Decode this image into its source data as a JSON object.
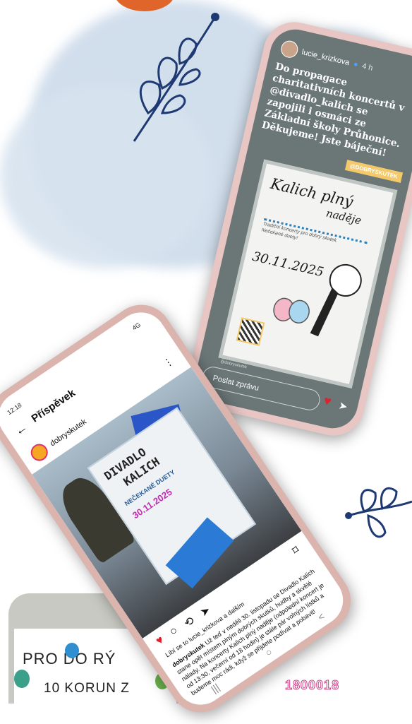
{
  "colors": {
    "accent_orange": "#e0652a",
    "leaf_navy": "#1f3a73",
    "like_red": "#e0202c",
    "wash_blue": "#b9cbe0"
  },
  "story": {
    "username": "lucie_krizkova",
    "time": "4 h",
    "text": "Do propagace charitativních koncertů v @divadlo_kalich se zapojili i osmáci ze Základní školy Průhonice. Děkujeme! Jste báječní!",
    "tag": "@DOBRYSKUTEK",
    "poster_title": "Kalich plný",
    "poster_subtitle": "naděje",
    "poster_small": "Tradiční koncerty pro dobrý skutek. Nečekané duety!",
    "poster_date": "30.11.2025",
    "watermark": "@dobryskutek",
    "reply_placeholder": "Poslat zprávu",
    "icons": [
      "heart-icon",
      "send-icon"
    ]
  },
  "post": {
    "status_time": "12:18",
    "status_right": "4G",
    "page_title": "Příspěvek",
    "username": "dobryskutek",
    "poster_line1": "DIVADLO",
    "poster_line2": "KALICH",
    "poster_line3": "NEČEKANÉ DUETY",
    "poster_date": "30.11.2025",
    "likes_line": "Líbí se to lucie_krizkova a dalším",
    "caption_user": "dobryskutek",
    "caption_text": "Už teď v neděli 30. listopadu se Divadlo Kalich stane opět místem plným dobrých skutků, hudby a skvělé nálady. Na koncerty Kalich plný naděje (odpolední koncert je od 13:30, večerní od 18 hodin) je stále pár volných lístků a budeme moc rádi, když se přijdete podívat a pobavit!"
  },
  "board": {
    "line1": "PRO DO RÝ",
    "line2": "10 KORUN Z",
    "sticker": "1800018"
  }
}
